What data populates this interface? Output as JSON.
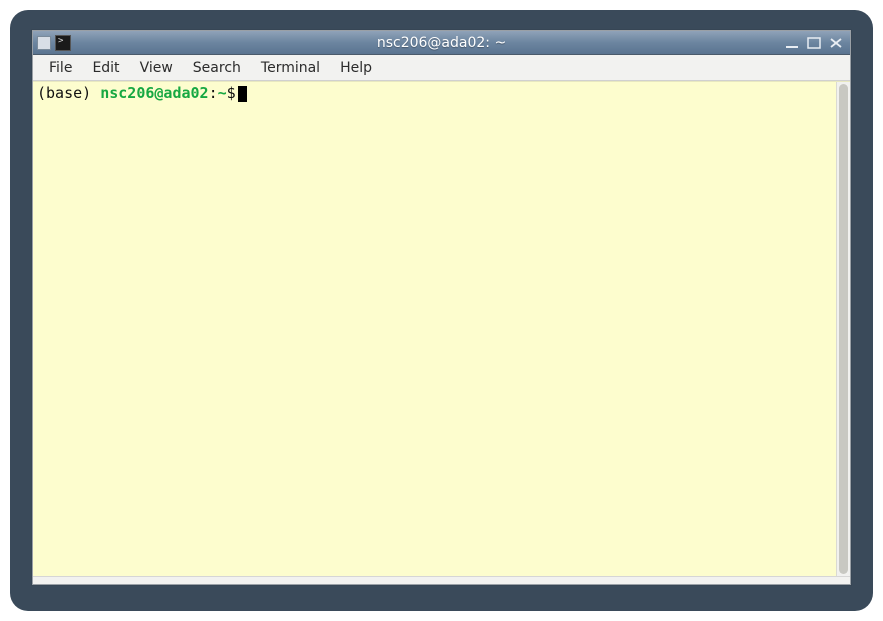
{
  "window": {
    "title": "nsc206@ada02: ~"
  },
  "menubar": {
    "items": [
      "File",
      "Edit",
      "View",
      "Search",
      "Terminal",
      "Help"
    ]
  },
  "terminal": {
    "prompt": {
      "env_prefix": "(base) ",
      "user_host": "nsc206@ada02",
      "separator": ":",
      "path": "~",
      "symbol": "$"
    },
    "input": ""
  },
  "colors": {
    "terminal_bg": "#fdfdce",
    "prompt_green": "#17a842",
    "titlebar_gradient_top": "#8fa2b8",
    "titlebar_gradient_bottom": "#5a7490",
    "outer_frame": "#3a4a5a"
  },
  "icons": {
    "window_menu": "window-menu-icon",
    "app": "terminal-app-icon",
    "minimize": "minimize-icon",
    "maximize": "maximize-icon",
    "close": "close-icon"
  }
}
